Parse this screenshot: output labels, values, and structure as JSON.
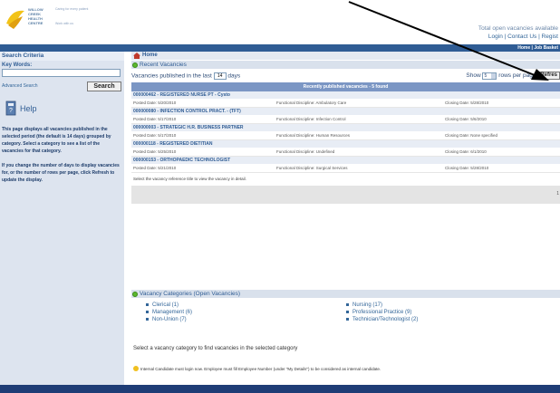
{
  "header": {
    "logo_name": "WILLOW CREEK HEALTH CENTRE",
    "logo_tagline": "Caring for every patient",
    "logo_tagline2": "Work with us",
    "total_vacancies": "Total open vacancies available",
    "links": "Login | Contact Us | Regist",
    "nav_links": "Home  |  Job Basket"
  },
  "sidebar": {
    "title": "Search Criteria",
    "keywords_label": "Key Words:",
    "keywords_value": "",
    "advanced_search": "Advanced Search",
    "search_button": "Search",
    "help_title": "Help",
    "help_p1": "This page displays all vacancies published in the selected period (the default is 14 days) grouped by category. Select a category to see a list of the vacancies for that category.",
    "help_p2": "If you change the number of days to display vacancies for, or the number of rows per page, click Refresh to update the display."
  },
  "main": {
    "home": "Home",
    "recent_title": "Recent Vacancies",
    "published_prefix": "Vacancies published in the last",
    "days_value": "14",
    "days_suffix": "days",
    "show_label": "Show",
    "rows_value": "5",
    "rows_suffix": "rows per page",
    "refresh_button": "Refres",
    "table_header": "Recently published vacancies - 5 found",
    "vacancies": [
      {
        "title": "000000462 - REGISTERED NURSE PT - Cysto",
        "posted": "Posted Date: 5/20/2010",
        "discipline": "Functional Discipline: Ambulatory Care",
        "closing": "Closing Date: 5/28/2010"
      },
      {
        "title": "000000080 - INFECTION CONTROL PRACT. - (TFT)",
        "posted": "Posted Date: 5/17/2010",
        "discipline": "Functional Discipline: Infection Control",
        "closing": "Closing Date: 5/6/2010"
      },
      {
        "title": "000000003 - STRATEGIC H.R. BUSINESS PARTNER",
        "posted": "Posted Date: 5/17/2010",
        "discipline": "Functional Discipline: Human Resources",
        "closing": "Closing Date: None specified"
      },
      {
        "title": "000000118 - REGISTERED DIETITIAN",
        "posted": "Posted Date: 5/25/2010",
        "discipline": "Functional Discipline: Undefined",
        "closing": "Closing Date: 6/1/2010"
      },
      {
        "title": "000000153 - ORTHOPAEDIC TECHNOLOGIST",
        "posted": "Posted Date: 5/21/2010",
        "discipline": "Functional Discipline: Surgical Services",
        "closing": "Closing Date: 5/28/2010"
      }
    ],
    "table_footer": "Select the vacancy reference title to view the vacancy in detail.",
    "page_number": "1",
    "categories_title": "Vacancy Categories (Open Vacancies)",
    "categories_col1": [
      "Clerical (1)",
      "Management (6)",
      "Non-Union (7)"
    ],
    "categories_col2": [
      "Nursing (17)",
      "Professional Practice (9)",
      "Technician/Technologist (2)"
    ],
    "category_help": "Select a vacancy category to find vacancies in the selected category",
    "notice": "Internal Candidate must login now. Employee must fill Employee Number (under \"My Details\") to be considered as internal candidate."
  },
  "colors": {
    "nav_blue": "#2f5c94",
    "footer_blue": "#1f3d76",
    "table_header": "#7b96c4",
    "sidebar_bg": "#dde4ef",
    "category_bullet": "#336699",
    "status_green": "#5cb82e"
  }
}
